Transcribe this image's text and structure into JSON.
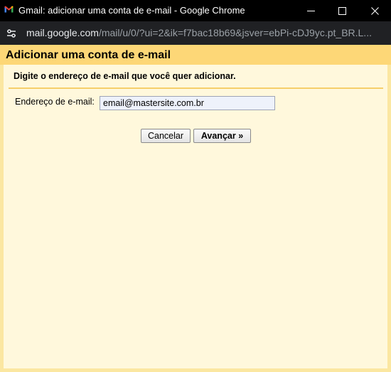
{
  "window": {
    "title": "Gmail: adicionar uma conta de e-mail - Google Chrome",
    "minimize_glyph": "—",
    "close_glyph": "✕"
  },
  "address_bar": {
    "host": "mail.google.com",
    "path": "/mail/u/0/?ui=2&ik=f7bac18b69&jsver=ebPi-cDJ9yc.pt_BR.L..."
  },
  "dialog": {
    "title": "Adicionar uma conta de e-mail",
    "subtitle": "Digite o endereço de e-mail que você quer adicionar.",
    "email_label": "Endereço de e-mail:",
    "email_value": "email@mastersite.com.br",
    "cancel_label": "Cancelar",
    "next_label": "Avançar »"
  },
  "colors": {
    "header_bg": "#fdd777",
    "content_bg": "#fff8dc",
    "divider": "#f6cf6a",
    "titlebar_bg": "#000000",
    "addressbar_bg": "#202124"
  },
  "icons": {
    "favicon": "gmail-icon",
    "site_info": "tune-icon"
  }
}
